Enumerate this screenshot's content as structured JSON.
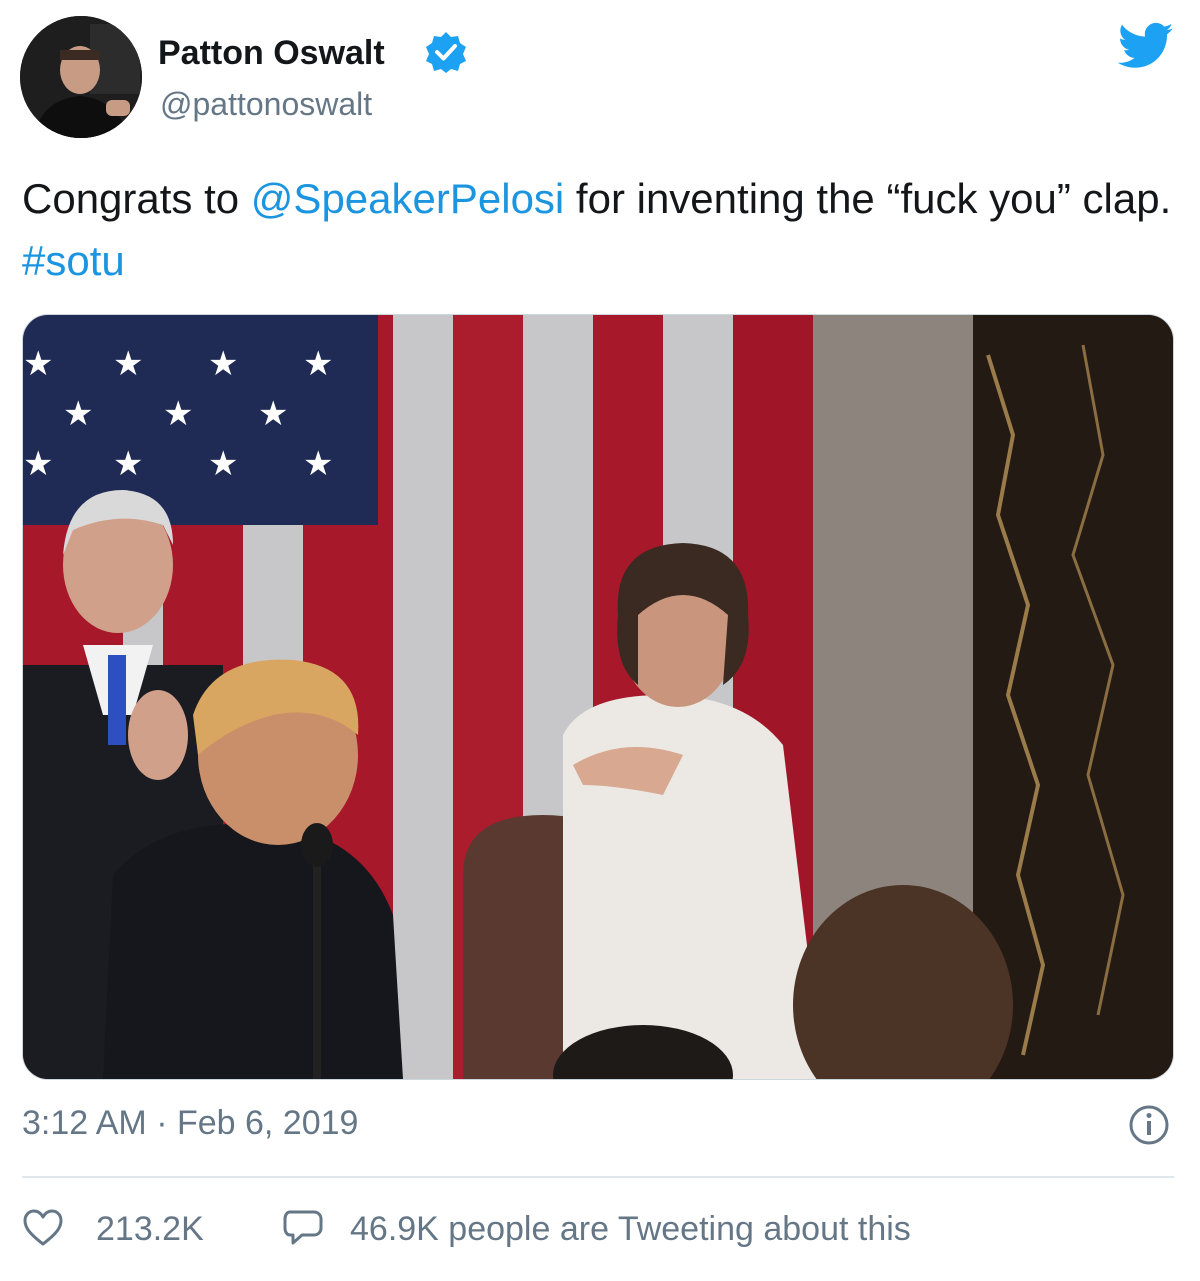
{
  "author": {
    "display_name": "Patton Oswalt",
    "handle": "@pattonoswalt",
    "verified": true,
    "avatar_icon": "profile-photo"
  },
  "brand": {
    "logo_icon": "twitter-bird-icon",
    "color": "#1da1f2"
  },
  "tweet": {
    "text_part1": "Congrats to ",
    "mention": "@SpeakerPelosi",
    "text_part2": " for inventing the “fuck you” clap. ",
    "hashtag": "#sotu",
    "link_color": "#1b95e0"
  },
  "media": {
    "kind": "photo",
    "icon": "photo"
  },
  "meta": {
    "timestamp": "3:12 AM · Feb 6, 2019",
    "info_icon": "info-icon"
  },
  "engagement": {
    "like_icon": "heart-icon",
    "likes": "213.2K",
    "reply_icon": "speech-bubble-icon",
    "tweeting": "46.9K people are Tweeting about this"
  }
}
